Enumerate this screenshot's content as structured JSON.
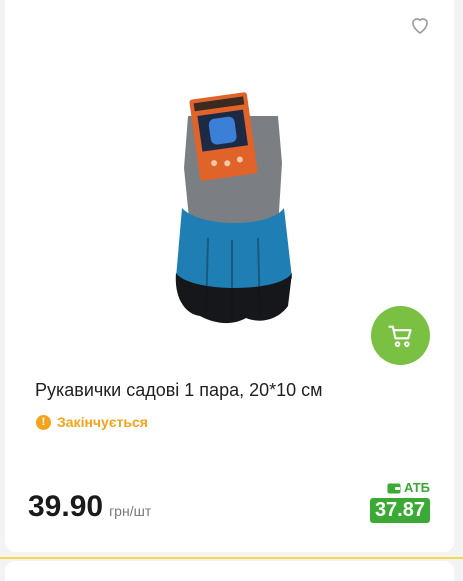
{
  "product": {
    "title": "Рукавички садові 1 пара, 20*10 см",
    "status": "Закінчується",
    "price": "39.90",
    "unit": "грн/шт",
    "promo_brand": "АТБ",
    "promo_price": "37.87"
  },
  "colors": {
    "cart_button": "#7ac143",
    "status": "#f5a31a",
    "promo": "#3aaa35",
    "glove_blue": "#1f7fb5",
    "glove_grey": "#7b7e83"
  },
  "icons": {
    "favorite": "heart-icon",
    "cart": "cart-icon",
    "status": "warning-icon",
    "promo": "wallet-icon"
  }
}
